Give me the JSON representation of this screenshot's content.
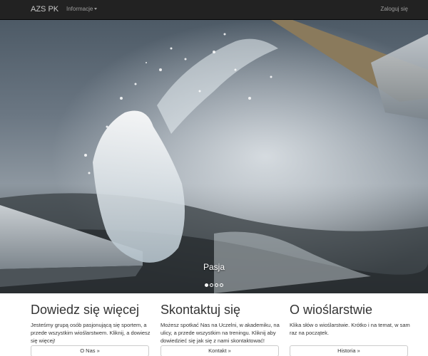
{
  "navbar": {
    "brand": "AZS PK",
    "dropdown_label": "Informacje",
    "login_label": "Zaloguj się"
  },
  "carousel": {
    "caption": "Pasja",
    "slides_count": 4,
    "active_slide": 1
  },
  "columns": [
    {
      "title": "Dowiedz się więcej",
      "text": "Jesteśmy grupą osób pasjonującą się sportem, a przede wszystkim wioślarstwem. Kliknij, a dowiesz się więcej!",
      "button": "O Nas »"
    },
    {
      "title": "Skontaktuj się",
      "text": "Możesz spotkać Nas na Uczelni, w akademiku, na ulicy, a przede wszystkim na treningu. Kliknij aby dowiedzieć się jak się z nami skontaktować!",
      "button": "Kontakt »"
    },
    {
      "title": "O wioślarstwie",
      "text": "Klika słów o wioślarstwie. Krótko i na temat, w sam raz na początek.",
      "button": "Historia »"
    }
  ]
}
